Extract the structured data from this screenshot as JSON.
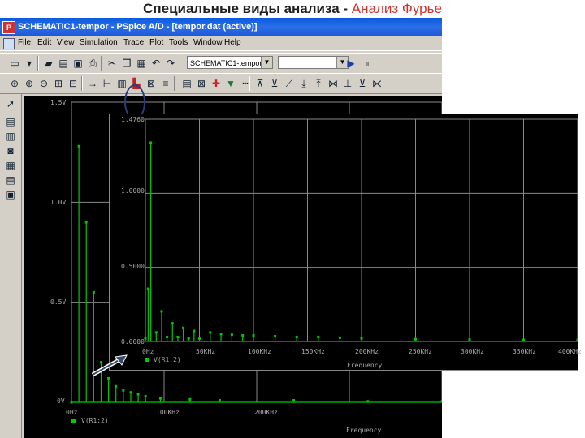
{
  "slide_title": {
    "main": "Специальные виды анализа - ",
    "accent": "Анализ Фурье"
  },
  "window": {
    "title": "SCHEMATIC1-tempor - PSpice A/D - [tempor.dat (active)]"
  },
  "menu": [
    "File",
    "Edit",
    "View",
    "Simulation",
    "Trace",
    "Plot",
    "Tools",
    "Window",
    "Help"
  ],
  "toolbar": {
    "profile_select": "SCHEMATIC1-tempor",
    "search_value": ""
  },
  "colors": {
    "trace": "#00c800",
    "grid": "#8a8a8a",
    "background": "#000000"
  },
  "main_plot": {
    "y_ticks": [
      "1.5V",
      "1.0V",
      "0.5V",
      "0V"
    ],
    "x_ticks": [
      "0Hz",
      "100KHz",
      "200KHz"
    ],
    "trace_label": "V(R1:2)",
    "x_title": "Frequency"
  },
  "inset_plot": {
    "y_ticks": [
      "1.4760",
      "1.0000",
      "0.5000",
      "0.0000"
    ],
    "x_ticks": [
      "0Hz",
      "50KHz",
      "100KHz",
      "150KHz",
      "200KHz",
      "250KHz",
      "300KHz",
      "350KHz",
      "400KHz"
    ],
    "trace_label": "V(R1:2)",
    "x_title": "Frequency"
  },
  "chart_data": [
    {
      "type": "line",
      "title": "",
      "xlabel": "Frequency",
      "ylabel": "",
      "xlim": [
        0,
        250000
      ],
      "ylim": [
        0,
        1.5
      ],
      "grid": true,
      "series": [
        {
          "name": "V(R1:2)",
          "x": [
            0,
            5000,
            10000,
            15000,
            20000,
            25000,
            30000,
            35000,
            40000,
            45000,
            50000,
            60000,
            80000,
            100000,
            150000,
            200000,
            250000
          ],
          "y": [
            0,
            1.28,
            0.9,
            0.55,
            0.2,
            0.12,
            0.08,
            0.06,
            0.05,
            0.04,
            0.03,
            0.02,
            0.015,
            0.01,
            0.01,
            0.005,
            0.005
          ]
        }
      ]
    },
    {
      "type": "line",
      "title": "",
      "xlabel": "Frequency",
      "ylabel": "",
      "xlim": [
        0,
        400000
      ],
      "ylim": [
        0,
        1.476
      ],
      "grid": true,
      "series": [
        {
          "name": "V(R1:2)",
          "x": [
            0,
            2500,
            5000,
            10000,
            15000,
            20000,
            25000,
            30000,
            35000,
            40000,
            45000,
            50000,
            60000,
            70000,
            80000,
            90000,
            100000,
            120000,
            140000,
            160000,
            180000,
            200000,
            250000,
            300000,
            350000,
            400000
          ],
          "y": [
            0.02,
            0.35,
            1.32,
            0.06,
            0.2,
            0.03,
            0.12,
            0.03,
            0.09,
            0.02,
            0.07,
            0.02,
            0.06,
            0.05,
            0.045,
            0.04,
            0.04,
            0.035,
            0.03,
            0.03,
            0.025,
            0.02,
            0.015,
            0.012,
            0.01,
            0.01
          ]
        }
      ]
    }
  ]
}
